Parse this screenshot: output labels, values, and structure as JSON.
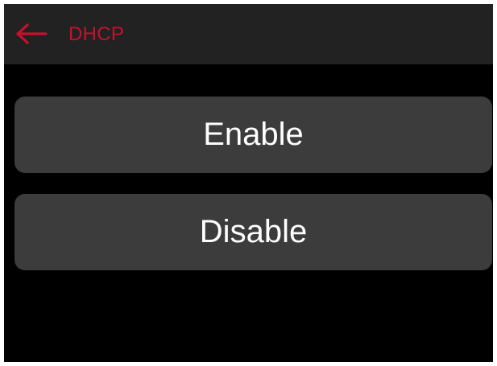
{
  "header": {
    "back_icon": "arrow-left-icon",
    "title": "DHCP",
    "accent_color": "#c8102e"
  },
  "options": [
    {
      "label": "Enable"
    },
    {
      "label": "Disable"
    }
  ]
}
